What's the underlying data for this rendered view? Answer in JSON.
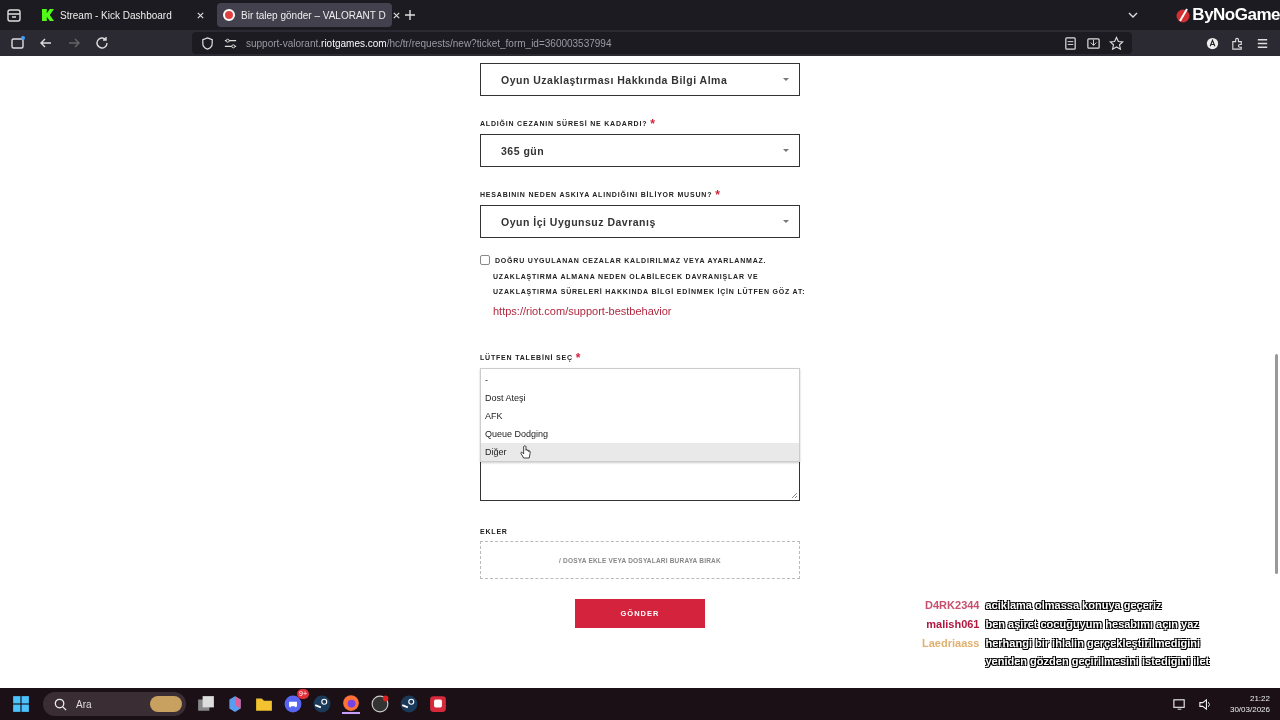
{
  "browser": {
    "tabs": [
      {
        "title": "Stream - Kick Dashboard",
        "selected": false
      },
      {
        "title": "Bir talep gönder – VALORANT D",
        "selected": true
      }
    ],
    "url": {
      "prefix": "support-valorant.",
      "host": "riotgames.com",
      "path": "/hc/tr/requests/new?ticket_form_id=360003537994"
    }
  },
  "overlay_logo": "ByNoGame",
  "form": {
    "first_select": "Oyun Uzaklaştırması Hakkında Bilgi Alma",
    "fields": [
      {
        "label": "ALDIĞIN CEZANIN SÜRESİ NE KADARDI?",
        "required_mark": "*",
        "value": "365 gün"
      },
      {
        "label": "HESABININ NEDEN ASKIYA ALINDIĞINI BİLİYOR MUSUN?",
        "required_mark": "*",
        "value": "Oyun İçi Uygunsuz Davranış"
      }
    ],
    "acknowledge": {
      "checked": false,
      "label": "DOĞRU UYGULANAN CEZALAR KALDIRILMAZ VEYA AYARLANMAZ.",
      "lines": [
        "UZAKLAŞTIRMA ALMANA NEDEN OLABİLECEK DAVRANIŞLAR VE",
        "UZAKLAŞTIRMA SÜRELERİ HAKKINDA BİLGİ EDİNMEK İÇİN LÜTFEN GÖZ AT:"
      ],
      "link": "https://riot.com/support-bestbehavior"
    },
    "request": {
      "label": "LÜTFEN TALEBİNİ SEÇ",
      "required_mark": "*",
      "options": [
        {
          "label": "-",
          "selected": false
        },
        {
          "label": "Dost Ateşi",
          "selected": false
        },
        {
          "label": "AFK",
          "selected": false
        },
        {
          "label": "Queue Dodging",
          "selected": false
        },
        {
          "label": "Diğer",
          "selected": true
        }
      ]
    },
    "attachments": {
      "label": "EKLER",
      "dropzone": "/ DOSYA EKLE VEYA DOSYALARI BURAYA BIRAK"
    },
    "submit": "GÖNDER"
  },
  "chat": [
    {
      "user": "D4RK2344",
      "color": "#c8506e",
      "message": "aciklama olmassa konuya geçeriz"
    },
    {
      "user": "malish061",
      "color": "#b01840",
      "message": "ben aşiret cocuğuyum hesabımı açın yaz"
    },
    {
      "user": "Laedriaass",
      "color": "#e0b070",
      "message": "herhangi bir ihlalin gerçekleştirilmediğini yeniden gözden geçirilmesini istediğini ilet"
    }
  ],
  "taskbar": {
    "search_placeholder": "Ara",
    "discord_badge": "9+",
    "time": "21:22",
    "date": "30/03/2026"
  }
}
